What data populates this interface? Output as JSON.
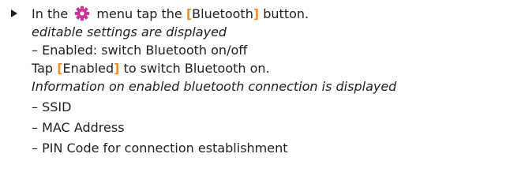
{
  "step1": {
    "before": "In the",
    "icon": "gear-icon",
    "middle": "menu tap the",
    "bracket_open": "[",
    "button_name": "Bluetooth",
    "bracket_close": "]",
    "after": "button."
  },
  "result1": "editable settings are displayed",
  "setting_enabled": "– Enabled: switch Bluetooth on/off",
  "step2": {
    "before": "Tap",
    "bracket_open": "[",
    "button_name": "Enabled",
    "bracket_close": "]",
    "after": "to switch Bluetooth on."
  },
  "result2": "Information on enabled bluetooth connection is displayed",
  "info_items": [
    "– SSID",
    "– MAC Address",
    "– PIN Code for connection establishment"
  ],
  "colors": {
    "bracket": "#f28c28",
    "gear": "#cc3399",
    "text": "#1e1e1e"
  }
}
